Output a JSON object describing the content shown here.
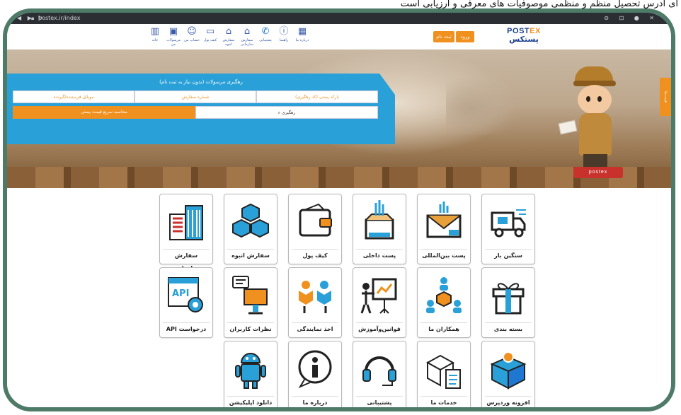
{
  "caption": "ای ادرس تحصیل منظم و منظمی موصوفیات های معرفی و ارزیابی است",
  "browser": {
    "url": "postex.ir/index",
    "controls": "⊖ ⊡ ● ✕"
  },
  "header": {
    "logo_en_a": "POST",
    "logo_en_b": "EX",
    "logo_fa": "پستکس",
    "login_button": "ورود",
    "register_button": "ثبت نام",
    "nav": [
      {
        "label": "درباره ما",
        "icon": "grid-icon",
        "glyph": "▦"
      },
      {
        "label": "راهنما",
        "icon": "info-icon",
        "glyph": "ⓘ"
      },
      {
        "label": "پشتیبانی",
        "icon": "phone-icon",
        "glyph": "✆"
      },
      {
        "label": "سفارش سازمانی",
        "icon": "building-icon",
        "glyph": "⌂"
      },
      {
        "label": "سفارش انبوه",
        "icon": "boxes-icon",
        "glyph": "⌂"
      },
      {
        "label": "کیف پول",
        "icon": "wallet-icon",
        "glyph": "▭"
      },
      {
        "label": "حساب من",
        "icon": "user-icon",
        "glyph": "☺"
      },
      {
        "label": "مرسولات من",
        "icon": "calendar-icon",
        "glyph": "▣"
      },
      {
        "label": "خانه",
        "icon": "home-icon",
        "glyph": "▥"
      }
    ]
  },
  "tracking": {
    "title": "رهگیری مرسولات (بدون نیاز به ثبت نام)",
    "field_barcode": "بارکد پستی (کد رهگیری)",
    "field_order": "شماره سفارش",
    "field_mobile": "موبایل فرستنده/گیرنده",
    "track_button": "رهگیری",
    "quote_button": "محاسبه سریع قیمت پستی"
  },
  "side_tab": "قیمت‌ها",
  "figure_brand": "postex",
  "services": [
    {
      "label": "سنگین بار",
      "icon": "truck-icon"
    },
    {
      "label": "پست بین‌المللی",
      "icon": "international-mail-icon"
    },
    {
      "label": "پست داخلی",
      "icon": "domestic-parcel-icon"
    },
    {
      "label": "کیف پول",
      "icon": "wallet-icon"
    },
    {
      "label": "سفارش انبوه",
      "icon": "stacked-boxes-icon"
    },
    {
      "label": "سفارش سازمانی",
      "icon": "office-building-icon"
    },
    {
      "label": "بسته بندی",
      "icon": "gift-box-icon"
    },
    {
      "label": "همکاران ما",
      "icon": "partners-icon"
    },
    {
      "label": "قوانین‌وآموزش",
      "icon": "presentation-board-icon"
    },
    {
      "label": "اخذ نمایندگی",
      "icon": "agency-people-icon"
    },
    {
      "label": "نظرات کاربران",
      "icon": "user-feedback-icon"
    },
    {
      "label": "درخواست API",
      "icon": "api-gear-icon"
    },
    {
      "label": "افزونه وردپرس",
      "icon": "wordpress-box-icon"
    },
    {
      "label": "خدمات ما",
      "icon": "clipboard-box-icon"
    },
    {
      "label": "پشتیبانی",
      "icon": "headset-icon"
    },
    {
      "label": "درباره ما",
      "icon": "info-bubble-icon"
    },
    {
      "label": "دانلود اپلیکیشن",
      "icon": "android-icon"
    }
  ],
  "colors": {
    "frame": "#4e7a68",
    "brand_orange": "#f0901e",
    "brand_blue": "#2aa0d8",
    "navy": "#1a3f8f"
  }
}
